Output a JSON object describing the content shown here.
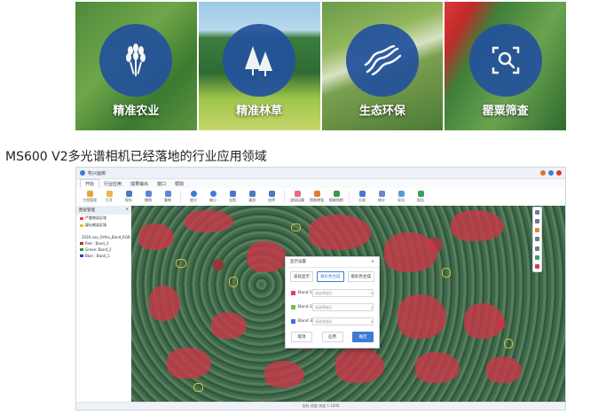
{
  "banner": {
    "tiles": [
      {
        "label": "精准农业",
        "icon": "wheat-icon"
      },
      {
        "label": "精准林草",
        "icon": "pine-trees-icon"
      },
      {
        "label": "生态环保",
        "icon": "river-icon"
      },
      {
        "label": "罂粟筛查",
        "icon": "magnify-icon"
      }
    ],
    "circle_color": "#24529c"
  },
  "caption": "MS600 V2多光谱相机已经落地的行业应用领域",
  "app": {
    "title": "牧兴画廊",
    "menu": [
      "开始",
      "行业应用",
      "成果输出",
      "窗口",
      "帮助"
    ],
    "toolbar": [
      "工程管理",
      "打开",
      "保存",
      "撤销",
      "重做",
      "放大",
      "缩小",
      "全图",
      "漫游",
      "选择",
      "波段运算",
      "图像增强",
      "植被指数",
      "分类",
      "统计",
      "导出",
      "报告"
    ],
    "sidebar": {
      "title": "图层管理",
      "layers": [
        "严重感染区域",
        "疑似感染区域",
        "2020.xxx_Ortho_Band_RGB"
      ],
      "bands": [
        {
          "label": "Red : Band_3",
          "color": "#d02020"
        },
        {
          "label": "Green: Band_2",
          "color": "#20a020"
        },
        {
          "label": "Blue : Band_1",
          "color": "#2040d0"
        }
      ]
    },
    "status": "坐标  经度  纬度  1:1000",
    "dialog": {
      "title": "显示设置",
      "close": "×",
      "tabs": [
        "波段显示",
        "真彩色合成",
        "假彩色合成"
      ],
      "bands": [
        {
          "label": "Band 1",
          "color": "#e0406a",
          "placeholder": "请选择波段"
        },
        {
          "label": "Band 2",
          "color": "#70c040",
          "placeholder": "请选择波段"
        },
        {
          "label": "Band 3",
          "color": "#4070d8",
          "placeholder": "请选择波段"
        }
      ],
      "buttons": [
        "取消",
        "应用",
        "确定"
      ]
    }
  }
}
